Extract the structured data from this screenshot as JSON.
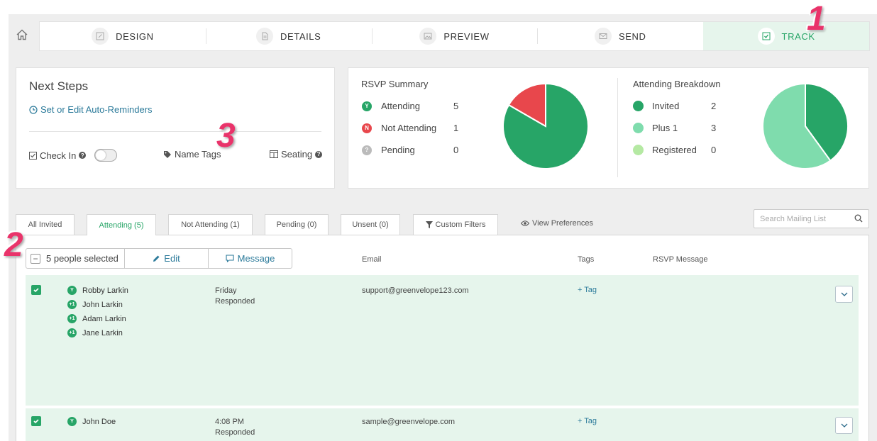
{
  "nav": {
    "steps": [
      "DESIGN",
      "DETAILS",
      "PREVIEW",
      "SEND",
      "TRACK"
    ],
    "active": "TRACK",
    "accent": "#27a567"
  },
  "next_steps": {
    "title": "Next Steps",
    "reminder_link": "Set or Edit Auto-Reminders",
    "check_in": "Check In",
    "name_tags": "Name Tags",
    "seating": "Seating"
  },
  "rsvp_summary": {
    "title": "RSVP Summary",
    "rows": [
      {
        "badge": "Y",
        "label": "Attending",
        "count": "5",
        "color": "#27a567"
      },
      {
        "badge": "N",
        "label": "Not Attending",
        "count": "1",
        "color": "#e8474c"
      },
      {
        "badge": "?",
        "label": "Pending",
        "count": "0",
        "color": "#bbbbbb"
      }
    ],
    "chart_values": [
      5,
      1,
      0
    ]
  },
  "breakdown": {
    "title": "Attending Breakdown",
    "rows": [
      {
        "label": "Invited",
        "count": "2",
        "color": "#27a567"
      },
      {
        "label": "Plus 1",
        "count": "3",
        "color": "#7fdcad"
      },
      {
        "label": "Registered",
        "count": "0",
        "color": "#b5e9a3"
      }
    ],
    "chart_values": [
      2,
      3,
      0
    ]
  },
  "tabs": [
    "All Invited",
    "Attending (5)",
    "Not Attending (1)",
    "Pending (0)",
    "Unsent (0)",
    "Custom Filters"
  ],
  "active_tab": "Attending (5)",
  "view_preferences": "View Preferences",
  "search_placeholder": "Search Mailing List",
  "bulk": {
    "selected": "5 people selected",
    "edit": "Edit",
    "message": "Message"
  },
  "columns": {
    "email": "Email",
    "tags": "Tags",
    "rsvp_message": "RSVP Message"
  },
  "rows": [
    {
      "guests": [
        {
          "badge": "Y",
          "name": "Robby Larkin"
        },
        {
          "badge": "+1",
          "name": "John Larkin"
        },
        {
          "badge": "+1",
          "name": "Adam Larkin"
        },
        {
          "badge": "+1",
          "name": "Jane Larkin"
        }
      ],
      "when": "Friday",
      "status": "Responded",
      "email": "support@greenvelope123.com",
      "tag": "+ Tag"
    },
    {
      "guests": [
        {
          "badge": "Y",
          "name": "John Doe"
        }
      ],
      "when": "4:08 PM",
      "status": "Responded",
      "email": "sample@greenvelope.com",
      "tag": "+ Tag"
    }
  ],
  "callouts": [
    "1",
    "2",
    "3"
  ]
}
